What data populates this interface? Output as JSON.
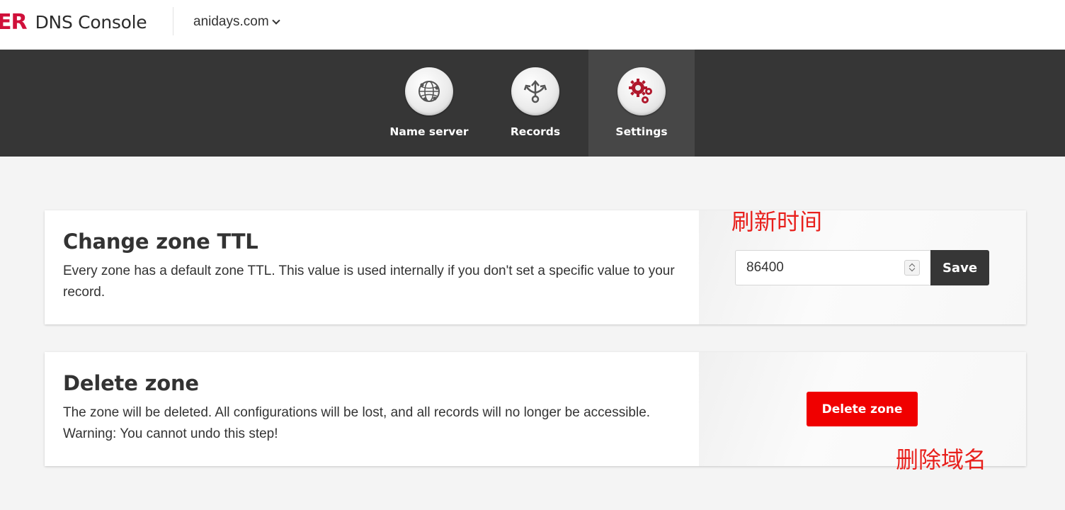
{
  "header": {
    "brand_mark": "ER",
    "title": "DNS Console",
    "domain": "anidays.com"
  },
  "nav": {
    "items": [
      {
        "label": "Name server",
        "icon": "globe-network-icon"
      },
      {
        "label": "Records",
        "icon": "branch-arrows-icon"
      },
      {
        "label": "Settings",
        "icon": "gears-icon",
        "active": true
      }
    ]
  },
  "ttl_card": {
    "title": "Change zone TTL",
    "description": "Every zone has a default zone TTL. This value is used internally if you don't set a specific value to your record.",
    "ttl_value": "86400",
    "save_label": "Save",
    "annotation": "刷新时间"
  },
  "delete_card": {
    "title": "Delete zone",
    "description": "The zone will be deleted. All configurations will be lost, and all records will no longer be accessible. Warning: You cannot undo this step!",
    "button_label": "Delete zone",
    "annotation": "删除域名"
  },
  "colors": {
    "brand": "#d0103a",
    "nav_bg": "#363636",
    "nav_active": "#474747",
    "danger": "#f00000",
    "annotation": "#e8201c"
  }
}
